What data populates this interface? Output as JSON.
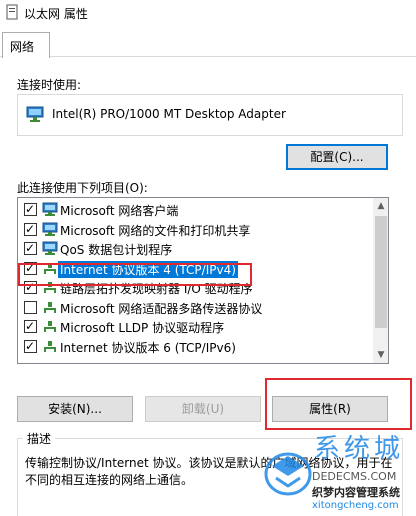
{
  "window": {
    "title": "以太网 属性"
  },
  "tabs": [
    {
      "label": "网络"
    }
  ],
  "connect_label": "连接时使用:",
  "adapter": {
    "name": "Intel(R) PRO/1000 MT Desktop Adapter"
  },
  "configure_button": "配置(C)...",
  "items_label": "此连接使用下列项目(O):",
  "items": [
    {
      "label": "Microsoft 网络客户端",
      "checked": true,
      "icon": "network-client-icon"
    },
    {
      "label": "Microsoft 网络的文件和打印机共享",
      "checked": true,
      "icon": "network-client-icon"
    },
    {
      "label": "QoS 数据包计划程序",
      "checked": true,
      "icon": "network-client-icon"
    },
    {
      "label": "Internet 协议版本 4 (TCP/IPv4)",
      "checked": true,
      "icon": "protocol-icon",
      "selected": true
    },
    {
      "label": "链路层拓扑发现映射器 I/O 驱动程序",
      "checked": true,
      "icon": "protocol-icon"
    },
    {
      "label": "Microsoft 网络适配器多路传送器协议",
      "checked": false,
      "icon": "protocol-icon"
    },
    {
      "label": "Microsoft LLDP 协议驱动程序",
      "checked": true,
      "icon": "protocol-icon"
    },
    {
      "label": "Internet 协议版本 6 (TCP/IPv6)",
      "checked": true,
      "icon": "protocol-icon"
    }
  ],
  "buttons": {
    "install": "安装(N)...",
    "uninstall": "卸载(U)",
    "properties": "属性(R)"
  },
  "description": {
    "title": "描述",
    "text": "传输控制协议/Internet 协议。该协议是默认的广域网络协议，用于在不同的相互连接的网络上通信。"
  },
  "watermark": {
    "brand": "系统城",
    "line1": "织梦内容管理系统",
    "line2": "DEDECMS.COM",
    "url": "xitongcheng.com"
  },
  "colors": {
    "selection": "#0078d7",
    "highlight": "#e0282e",
    "focus": "#0078d7"
  }
}
